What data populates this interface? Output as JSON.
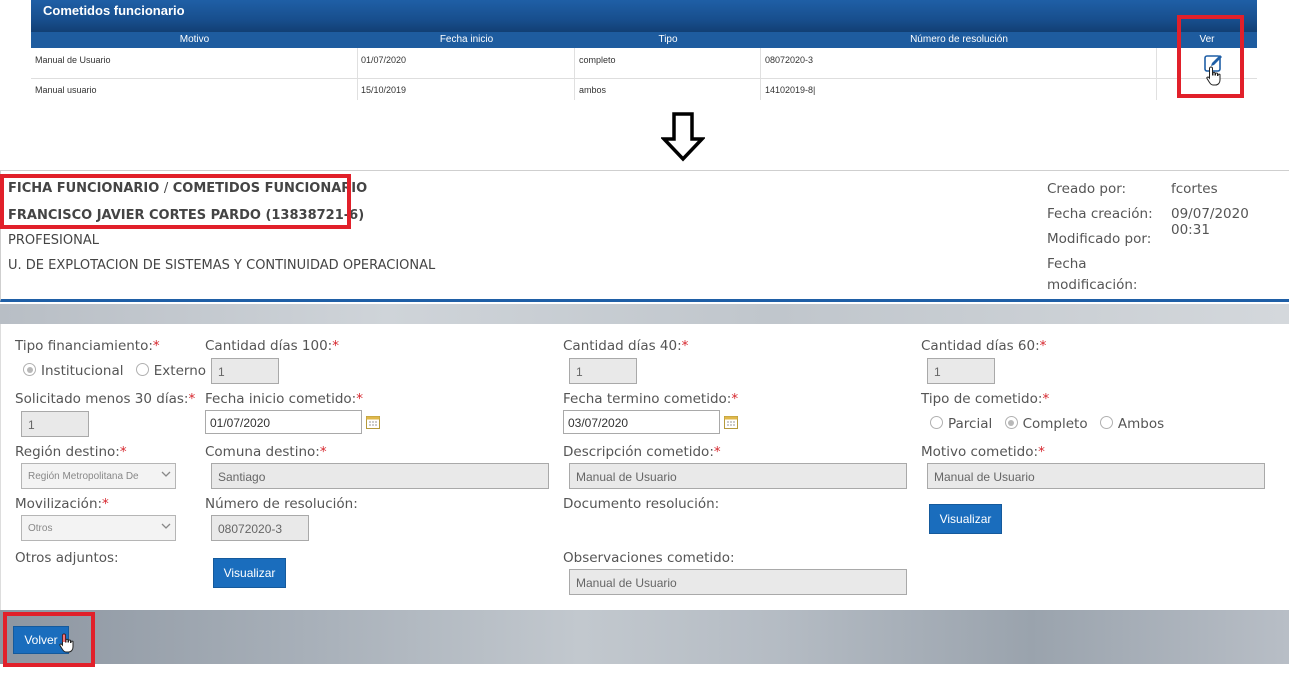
{
  "top_table": {
    "title": "Cometidos funcionario",
    "columns": [
      "Motivo",
      "Fecha inicio",
      "Tipo",
      "Número de resolución",
      "Ver"
    ],
    "rows": [
      {
        "motivo": "Manual de Usuario",
        "fecha_inicio": "01/07/2020",
        "tipo": "completo",
        "numero_resolucion": "08072020-3"
      },
      {
        "motivo": "Manual usuario",
        "fecha_inicio": "15/10/2019",
        "tipo": "ambos",
        "numero_resolucion": "14102019-8|"
      }
    ]
  },
  "header": {
    "breadcrumb_root": "FICHA FUNCIONARIO",
    "breadcrumb_sep": "/",
    "breadcrumb_current": "COMETIDOS FUNCIONARIO",
    "employee_name": "FRANCISCO JAVIER CORTES PARDO (13838721-6)",
    "position": "PROFESIONAL",
    "unit": "U. DE EXPLOTACION DE SISTEMAS Y CONTINUIDAD OPERACIONAL",
    "meta": {
      "created_by_label": "Creado por:",
      "created_by_value": "fcortes",
      "created_date_label": "Fecha creación:",
      "created_date_value": "09/07/2020 00:31",
      "modified_by_label": "Modificado por:",
      "modified_date_label_1": "Fecha",
      "modified_date_label_2": "modificación:"
    }
  },
  "form": {
    "tipo_financiamiento": {
      "label": "Tipo financiamiento:",
      "options": [
        "Institucional",
        "Externo"
      ],
      "selected": "Institucional"
    },
    "dias_100": {
      "label": "Cantidad días 100:",
      "value": "1"
    },
    "dias_40": {
      "label": "Cantidad días 40:",
      "value": "1"
    },
    "dias_60": {
      "label": "Cantidad días 60:",
      "value": "1"
    },
    "solicitado_30": {
      "label": "Solicitado menos 30 días:",
      "value": "1"
    },
    "fecha_inicio": {
      "label": "Fecha inicio cometido:",
      "value": "01/07/2020"
    },
    "fecha_termino": {
      "label": "Fecha termino cometido:",
      "value": "03/07/2020"
    },
    "tipo_cometido": {
      "label": "Tipo de cometido:",
      "options": [
        "Parcial",
        "Completo",
        "Ambos"
      ],
      "selected": "Completo"
    },
    "region_destino": {
      "label": "Región destino:",
      "value": "Región Metropolitana De"
    },
    "comuna_destino": {
      "label": "Comuna destino:",
      "value": "Santiago"
    },
    "descripcion": {
      "label": "Descripción cometido:",
      "value": "Manual de Usuario"
    },
    "motivo": {
      "label": "Motivo cometido:",
      "value": "Manual de Usuario"
    },
    "movilizacion": {
      "label": "Movilización:",
      "value": "Otros"
    },
    "numero_resolucion": {
      "label": "Número de resolución:",
      "value": "08072020-3"
    },
    "documento_resolucion": {
      "label": "Documento resolución:"
    },
    "otros_adjuntos": {
      "label": "Otros adjuntos:"
    },
    "observaciones": {
      "label": "Observaciones cometido:",
      "value": "Manual de Usuario"
    },
    "required_mark": "*",
    "visualizar_label": "Visualizar",
    "volver_label": "Volver"
  },
  "colors": {
    "accent": "#1a6dbd",
    "header_blue": "#1f5fa6",
    "highlight_red": "#e1202a",
    "required": "#d6262d"
  }
}
